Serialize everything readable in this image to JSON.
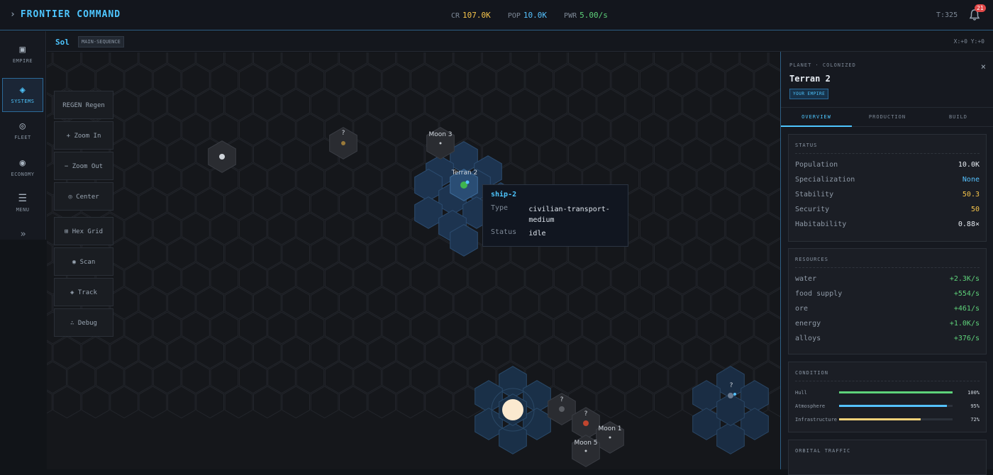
{
  "header": {
    "title": "FRONTIER COMMAND",
    "stats": [
      {
        "label": "CR",
        "value": "107.0K",
        "color": "#f5c44b"
      },
      {
        "label": "POP",
        "value": "10.0K",
        "color": "#55c2ff"
      },
      {
        "label": "PWR",
        "value": "5.00/s",
        "color": "#5ed27a"
      }
    ],
    "turn": "T:325",
    "notifications": "21"
  },
  "sidebar": {
    "items": [
      {
        "label": "EMPIRE",
        "icon": "empire-icon"
      },
      {
        "label": "SYSTEMS",
        "icon": "systems-icon",
        "active": true
      },
      {
        "label": "FLEET",
        "icon": "fleet-icon"
      },
      {
        "label": "ECONOMY",
        "icon": "economy-icon"
      },
      {
        "label": "MENU",
        "icon": "menu-icon"
      }
    ],
    "expand": "»"
  },
  "system": {
    "name": "Sol",
    "star_type": "MAIN-SEQUENCE",
    "coords": "X:+0 Y:+0"
  },
  "tools": [
    "REGEN Regen",
    "+ Zoom In",
    "− Zoom Out",
    "◎ Center",
    "⊞ Hex Grid",
    "◉ Scan",
    "◈ Track",
    "∴ Debug"
  ],
  "map": {
    "labels": {
      "moon3": "Moon 3",
      "terran2": "Terran 2",
      "moon1": "Moon 1",
      "moon5": "Moon 5",
      "unknown": "?"
    }
  },
  "tooltip": {
    "title": "ship-2",
    "type_label": "Type",
    "type_value": "civilian-transport-medium",
    "status_label": "Status",
    "status_value": "idle"
  },
  "panel": {
    "kind": "PLANET · COLONIZED",
    "name": "Terran 2",
    "owner": "YOUR EMPIRE",
    "close": "×",
    "tabs": [
      "OVERVIEW",
      "PRODUCTION",
      "BUILD"
    ],
    "status": {
      "title": "STATUS",
      "rows": [
        {
          "k": "Population",
          "v": "10.0K",
          "color": "#e5eaf0"
        },
        {
          "k": "Specialization",
          "v": "None",
          "color": "#55c2ff"
        },
        {
          "k": "Stability",
          "v": "50.3",
          "color": "#f5c44b"
        },
        {
          "k": "Security",
          "v": "50",
          "color": "#f5c44b"
        },
        {
          "k": "Habitability",
          "v": "0.88×",
          "color": "#e5eaf0"
        }
      ]
    },
    "resources": {
      "title": "RESOURCES",
      "rows": [
        {
          "k": "water",
          "v": "+2.3K/s"
        },
        {
          "k": "food supply",
          "v": "+554/s"
        },
        {
          "k": "ore",
          "v": "+461/s"
        },
        {
          "k": "energy",
          "v": "+1.0K/s"
        },
        {
          "k": "alloys",
          "v": "+376/s"
        }
      ]
    },
    "condition": {
      "title": "CONDITION",
      "rows": [
        {
          "k": "Hull",
          "v": "100%",
          "pct": 1.0,
          "color": "#5ed27a"
        },
        {
          "k": "Atmosphere",
          "v": "95%",
          "pct": 0.95,
          "color": "#55c2ff"
        },
        {
          "k": "Infrastructure",
          "v": "72%",
          "pct": 0.72,
          "color": "#f5d27a"
        }
      ]
    },
    "traffic_title": "ORBITAL TRAFFIC"
  }
}
